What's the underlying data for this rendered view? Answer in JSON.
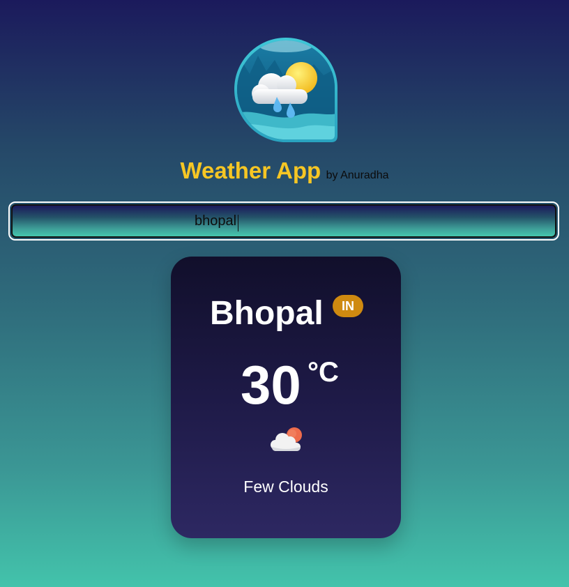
{
  "header": {
    "logo_icon": "weather-app-logo-icon",
    "title": "Weather App",
    "byline": "by Anuradha"
  },
  "search": {
    "value": "bhopal",
    "placeholder": ""
  },
  "weather": {
    "city": "Bhopal",
    "country": "IN",
    "temperature": "30",
    "unit": "°C",
    "condition_icon": "few-clouds-icon",
    "description": "Few Clouds"
  },
  "colors": {
    "title": "#f6c624",
    "badge": "#cf8a10",
    "card_top": "#110f2b",
    "card_bottom": "#2d2862",
    "page_top": "#1b1a5c",
    "page_bottom": "#43c3ab"
  }
}
